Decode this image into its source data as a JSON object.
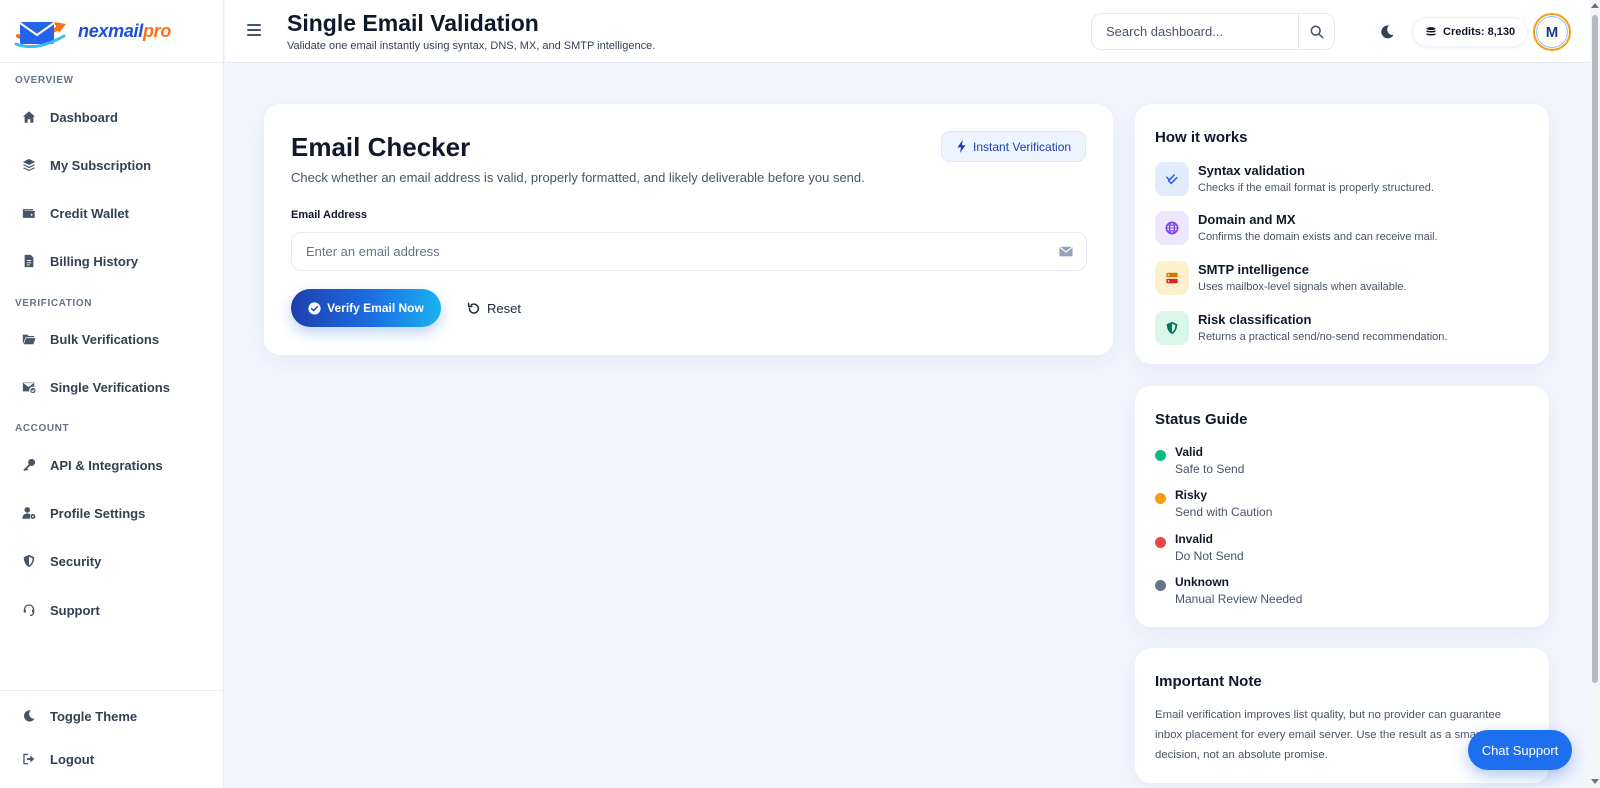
{
  "brand": {
    "name_part1": "nexmail",
    "name_part2": "pro",
    "accent": "#1d4ed8",
    "accent2": "#f97316"
  },
  "sidebar": {
    "sections": [
      "OVERVIEW",
      "VERIFICATION",
      "ACCOUNT"
    ],
    "items": [
      {
        "label": "Dashboard",
        "icon": "home-icon"
      },
      {
        "label": "My Subscription",
        "icon": "layers-icon"
      },
      {
        "label": "Credit Wallet",
        "icon": "wallet-icon"
      },
      {
        "label": "Billing History",
        "icon": "receipt-icon"
      },
      {
        "label": "Bulk Verifications",
        "icon": "folder-icon"
      },
      {
        "label": "Single Verifications",
        "icon": "mail-check-icon"
      },
      {
        "label": "API & Integrations",
        "icon": "key-icon"
      },
      {
        "label": "Profile Settings",
        "icon": "user-gear-icon"
      },
      {
        "label": "Security",
        "icon": "shield-icon"
      },
      {
        "label": "Support",
        "icon": "headset-icon"
      }
    ],
    "bottom": [
      {
        "label": "Toggle Theme",
        "icon": "moon-icon"
      },
      {
        "label": "Logout",
        "icon": "logout-icon"
      }
    ]
  },
  "header": {
    "title": "Single Email Validation",
    "subtitle": "Validate one email instantly using syntax, DNS, MX, and SMTP intelligence.",
    "search_placeholder": "Search dashboard...",
    "credits": "Credits: 8,130",
    "avatar_initial": "M"
  },
  "checker": {
    "title": "Email Checker",
    "description": "Check whether an email address is valid, properly formatted, and likely deliverable before you send.",
    "badge": "Instant Verification",
    "field_label": "Email Address",
    "field_placeholder": "Enter an email address",
    "verify_label": "Verify Email Now",
    "reset_label": "Reset"
  },
  "how": {
    "title": "How it works",
    "items": [
      {
        "title": "Syntax validation",
        "desc": "Checks if the email format is properly structured.",
        "icon": "check-double-icon",
        "color": "#2563eb"
      },
      {
        "title": "Domain and MX",
        "desc": "Confirms the domain exists and can receive mail.",
        "icon": "globe-icon",
        "color": "#7c3aed"
      },
      {
        "title": "SMTP intelligence",
        "desc": "Uses mailbox-level signals when available.",
        "icon": "server-icon",
        "color": "#d97706"
      },
      {
        "title": "Risk classification",
        "desc": "Returns a practical send/no-send recommendation.",
        "icon": "shield-check-icon",
        "color": "#059669"
      }
    ]
  },
  "status": {
    "title": "Status Guide",
    "items": [
      {
        "title": "Valid",
        "desc": "Safe to Send",
        "color": "#10b981"
      },
      {
        "title": "Risky",
        "desc": "Send with Caution",
        "color": "#f59e0b"
      },
      {
        "title": "Invalid",
        "desc": "Do Not Send",
        "color": "#ef4444"
      },
      {
        "title": "Unknown",
        "desc": "Manual Review Needed",
        "color": "#64748b"
      }
    ]
  },
  "note": {
    "title": "Important Note",
    "text": "Email verification improves list quality, but no provider can guarantee inbox placement for every email server. Use the result as a smart sending decision, not an absolute promise."
  },
  "chat": {
    "label": "Chat Support"
  }
}
